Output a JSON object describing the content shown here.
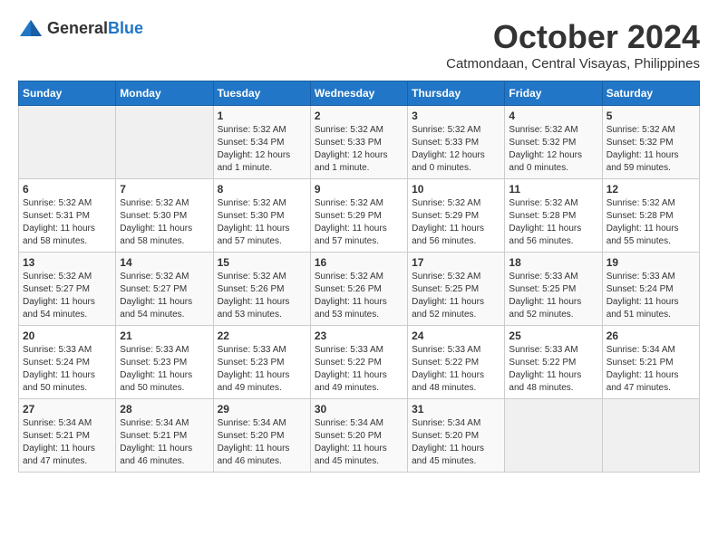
{
  "logo": {
    "general": "General",
    "blue": "Blue"
  },
  "header": {
    "month": "October 2024",
    "location": "Catmondaan, Central Visayas, Philippines"
  },
  "weekdays": [
    "Sunday",
    "Monday",
    "Tuesday",
    "Wednesday",
    "Thursday",
    "Friday",
    "Saturday"
  ],
  "weeks": [
    [
      null,
      null,
      {
        "day": "1",
        "sunrise": "Sunrise: 5:32 AM",
        "sunset": "Sunset: 5:34 PM",
        "daylight": "Daylight: 12 hours and 1 minute."
      },
      {
        "day": "2",
        "sunrise": "Sunrise: 5:32 AM",
        "sunset": "Sunset: 5:33 PM",
        "daylight": "Daylight: 12 hours and 1 minute."
      },
      {
        "day": "3",
        "sunrise": "Sunrise: 5:32 AM",
        "sunset": "Sunset: 5:33 PM",
        "daylight": "Daylight: 12 hours and 0 minutes."
      },
      {
        "day": "4",
        "sunrise": "Sunrise: 5:32 AM",
        "sunset": "Sunset: 5:32 PM",
        "daylight": "Daylight: 12 hours and 0 minutes."
      },
      {
        "day": "5",
        "sunrise": "Sunrise: 5:32 AM",
        "sunset": "Sunset: 5:32 PM",
        "daylight": "Daylight: 11 hours and 59 minutes."
      }
    ],
    [
      {
        "day": "6",
        "sunrise": "Sunrise: 5:32 AM",
        "sunset": "Sunset: 5:31 PM",
        "daylight": "Daylight: 11 hours and 58 minutes."
      },
      {
        "day": "7",
        "sunrise": "Sunrise: 5:32 AM",
        "sunset": "Sunset: 5:30 PM",
        "daylight": "Daylight: 11 hours and 58 minutes."
      },
      {
        "day": "8",
        "sunrise": "Sunrise: 5:32 AM",
        "sunset": "Sunset: 5:30 PM",
        "daylight": "Daylight: 11 hours and 57 minutes."
      },
      {
        "day": "9",
        "sunrise": "Sunrise: 5:32 AM",
        "sunset": "Sunset: 5:29 PM",
        "daylight": "Daylight: 11 hours and 57 minutes."
      },
      {
        "day": "10",
        "sunrise": "Sunrise: 5:32 AM",
        "sunset": "Sunset: 5:29 PM",
        "daylight": "Daylight: 11 hours and 56 minutes."
      },
      {
        "day": "11",
        "sunrise": "Sunrise: 5:32 AM",
        "sunset": "Sunset: 5:28 PM",
        "daylight": "Daylight: 11 hours and 56 minutes."
      },
      {
        "day": "12",
        "sunrise": "Sunrise: 5:32 AM",
        "sunset": "Sunset: 5:28 PM",
        "daylight": "Daylight: 11 hours and 55 minutes."
      }
    ],
    [
      {
        "day": "13",
        "sunrise": "Sunrise: 5:32 AM",
        "sunset": "Sunset: 5:27 PM",
        "daylight": "Daylight: 11 hours and 54 minutes."
      },
      {
        "day": "14",
        "sunrise": "Sunrise: 5:32 AM",
        "sunset": "Sunset: 5:27 PM",
        "daylight": "Daylight: 11 hours and 54 minutes."
      },
      {
        "day": "15",
        "sunrise": "Sunrise: 5:32 AM",
        "sunset": "Sunset: 5:26 PM",
        "daylight": "Daylight: 11 hours and 53 minutes."
      },
      {
        "day": "16",
        "sunrise": "Sunrise: 5:32 AM",
        "sunset": "Sunset: 5:26 PM",
        "daylight": "Daylight: 11 hours and 53 minutes."
      },
      {
        "day": "17",
        "sunrise": "Sunrise: 5:32 AM",
        "sunset": "Sunset: 5:25 PM",
        "daylight": "Daylight: 11 hours and 52 minutes."
      },
      {
        "day": "18",
        "sunrise": "Sunrise: 5:33 AM",
        "sunset": "Sunset: 5:25 PM",
        "daylight": "Daylight: 11 hours and 52 minutes."
      },
      {
        "day": "19",
        "sunrise": "Sunrise: 5:33 AM",
        "sunset": "Sunset: 5:24 PM",
        "daylight": "Daylight: 11 hours and 51 minutes."
      }
    ],
    [
      {
        "day": "20",
        "sunrise": "Sunrise: 5:33 AM",
        "sunset": "Sunset: 5:24 PM",
        "daylight": "Daylight: 11 hours and 50 minutes."
      },
      {
        "day": "21",
        "sunrise": "Sunrise: 5:33 AM",
        "sunset": "Sunset: 5:23 PM",
        "daylight": "Daylight: 11 hours and 50 minutes."
      },
      {
        "day": "22",
        "sunrise": "Sunrise: 5:33 AM",
        "sunset": "Sunset: 5:23 PM",
        "daylight": "Daylight: 11 hours and 49 minutes."
      },
      {
        "day": "23",
        "sunrise": "Sunrise: 5:33 AM",
        "sunset": "Sunset: 5:22 PM",
        "daylight": "Daylight: 11 hours and 49 minutes."
      },
      {
        "day": "24",
        "sunrise": "Sunrise: 5:33 AM",
        "sunset": "Sunset: 5:22 PM",
        "daylight": "Daylight: 11 hours and 48 minutes."
      },
      {
        "day": "25",
        "sunrise": "Sunrise: 5:33 AM",
        "sunset": "Sunset: 5:22 PM",
        "daylight": "Daylight: 11 hours and 48 minutes."
      },
      {
        "day": "26",
        "sunrise": "Sunrise: 5:34 AM",
        "sunset": "Sunset: 5:21 PM",
        "daylight": "Daylight: 11 hours and 47 minutes."
      }
    ],
    [
      {
        "day": "27",
        "sunrise": "Sunrise: 5:34 AM",
        "sunset": "Sunset: 5:21 PM",
        "daylight": "Daylight: 11 hours and 47 minutes."
      },
      {
        "day": "28",
        "sunrise": "Sunrise: 5:34 AM",
        "sunset": "Sunset: 5:21 PM",
        "daylight": "Daylight: 11 hours and 46 minutes."
      },
      {
        "day": "29",
        "sunrise": "Sunrise: 5:34 AM",
        "sunset": "Sunset: 5:20 PM",
        "daylight": "Daylight: 11 hours and 46 minutes."
      },
      {
        "day": "30",
        "sunrise": "Sunrise: 5:34 AM",
        "sunset": "Sunset: 5:20 PM",
        "daylight": "Daylight: 11 hours and 45 minutes."
      },
      {
        "day": "31",
        "sunrise": "Sunrise: 5:34 AM",
        "sunset": "Sunset: 5:20 PM",
        "daylight": "Daylight: 11 hours and 45 minutes."
      },
      null,
      null
    ]
  ]
}
